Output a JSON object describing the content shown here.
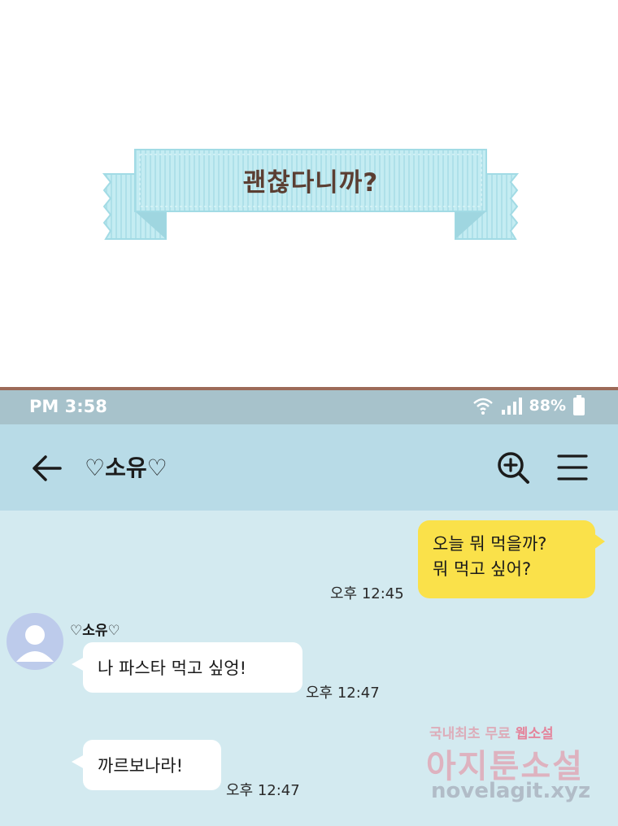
{
  "panel": {
    "caption": "괜찮다니까?"
  },
  "status_bar": {
    "time": "PM 3:58",
    "battery": "88%",
    "icons": [
      "wifi-icon",
      "signal-icon",
      "battery-icon"
    ]
  },
  "header": {
    "title": "♡소유♡",
    "icons": [
      "back-arrow-icon",
      "search-zoom-icon",
      "menu-icon"
    ]
  },
  "messages": [
    {
      "sender": "me",
      "lines": [
        "오늘 뭐 먹을까?",
        "뭐 먹고 싶어?"
      ],
      "time": "오후 12:45"
    },
    {
      "sender": "♡소유♡",
      "text": "나 파스타 먹고 싶엉!",
      "time": "오후 12:47"
    },
    {
      "sender": "♡소유♡",
      "text": "까르보나라!",
      "time": "오후 12:47"
    }
  ],
  "watermark": {
    "line1_a": "국내최초 무료 ",
    "line1_b": "웹소설",
    "line2": "아지툰소설",
    "line3": "novelagit.xyz"
  },
  "colors": {
    "ribbon": "#bfe8ef",
    "caption_text": "#5b3e32",
    "status_bar": "#a7c2cb",
    "header": "#b8dbe7",
    "chat_bg": "#d3eaf0",
    "my_bubble": "#fae14a",
    "their_bubble": "#ffffff",
    "avatar": "#bdcbeb"
  }
}
